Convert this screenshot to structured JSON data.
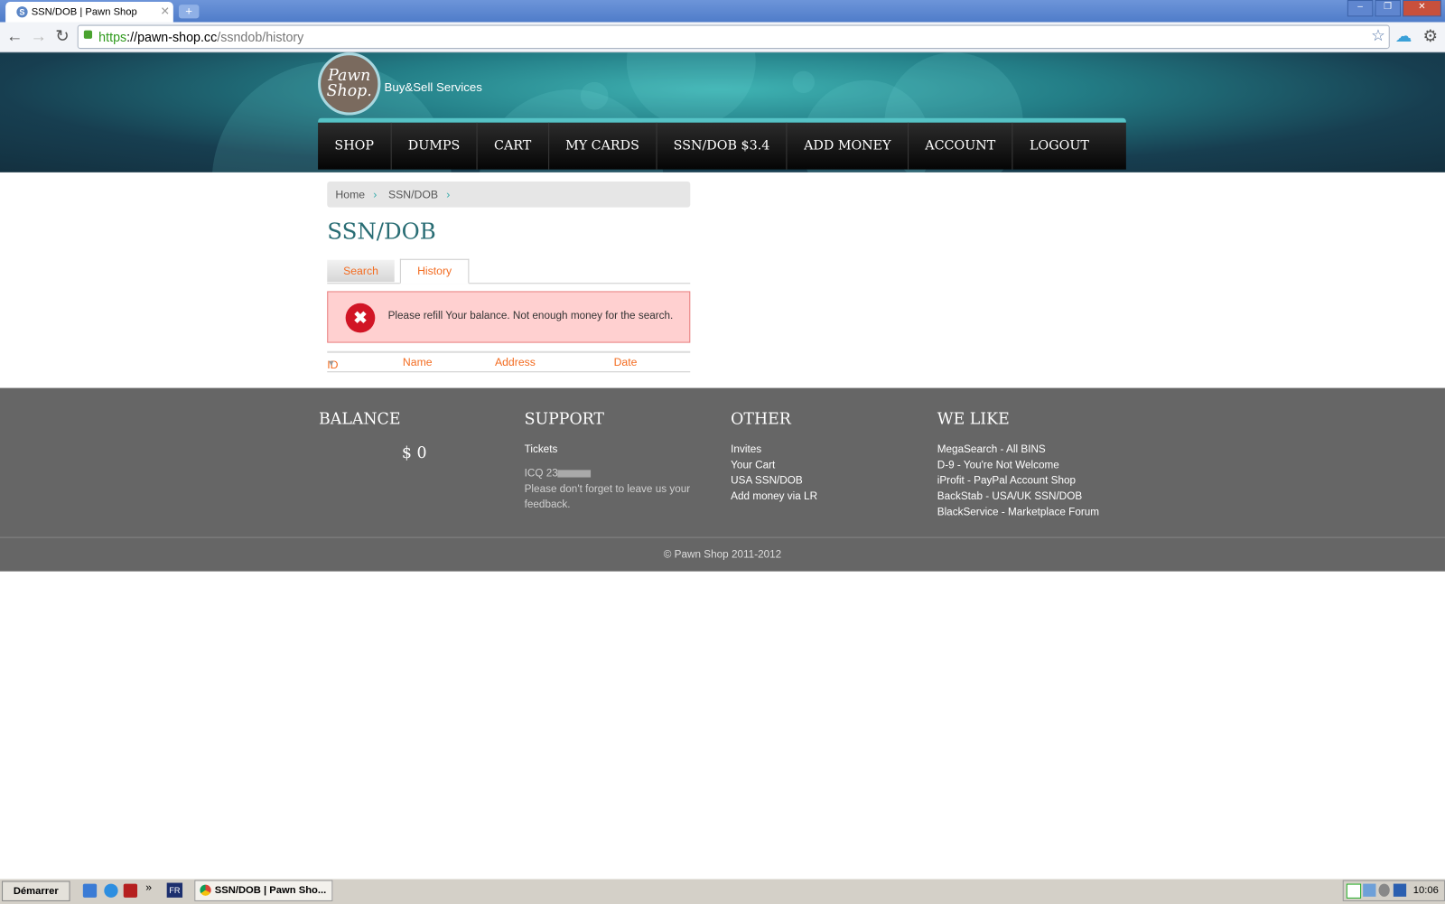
{
  "browser": {
    "tab_title": "SSN/DOB | Pawn Shop",
    "url_scheme": "https",
    "url_host": "://pawn-shop.cc",
    "url_path": "/ssndob/history"
  },
  "header": {
    "logo_text": "Pawn Shop.",
    "tagline": "Buy&Sell Services",
    "menu": [
      "SHOP",
      "DUMPS",
      "CART",
      "MY CARDS",
      "SSN/DOB $3.4",
      "ADD MONEY",
      "ACCOUNT",
      "LOGOUT"
    ]
  },
  "breadcrumb": [
    "Home",
    "SSN/DOB"
  ],
  "page_title": "SSN/DOB",
  "tabs": {
    "search": "Search",
    "history": "History",
    "active": "History"
  },
  "alert": {
    "message": "Please refill Your balance. Not enough money for the search.",
    "type": "error"
  },
  "table": {
    "columns": [
      "ID",
      "Name",
      "Address",
      "Date"
    ],
    "sorted_by": "ID",
    "rows": []
  },
  "footer": {
    "balance": {
      "heading": "BALANCE",
      "value": "$ 0"
    },
    "support": {
      "heading": "SUPPORT",
      "tickets": "Tickets",
      "icq": "ICQ 23",
      "note": "Please don't forget to leave us your feedback."
    },
    "other": {
      "heading": "OTHER",
      "links": [
        "Invites",
        "Your Cart",
        "USA SSN/DOB",
        "Add money via LR"
      ]
    },
    "we_like": {
      "heading": "WE LIKE",
      "links": [
        "MegaSearch - All BINS",
        "D-9 - You're Not Welcome",
        "iProfit - PayPal Account Shop",
        "BackStab - USA/UK SSN/DOB",
        "BlackService - Marketplace Forum"
      ]
    },
    "copyright": "© Pawn Shop 2011-2012"
  },
  "taskbar": {
    "start": "Démarrer",
    "lang": "FR",
    "task": "SSN/DOB | Pawn Sho...",
    "clock": "10:06"
  },
  "colors": {
    "accent": "#f36c21",
    "title": "#296d74",
    "menu_bar": "#56c3c6",
    "footer": "#666666",
    "alert_bg": "#ffd0d0"
  }
}
